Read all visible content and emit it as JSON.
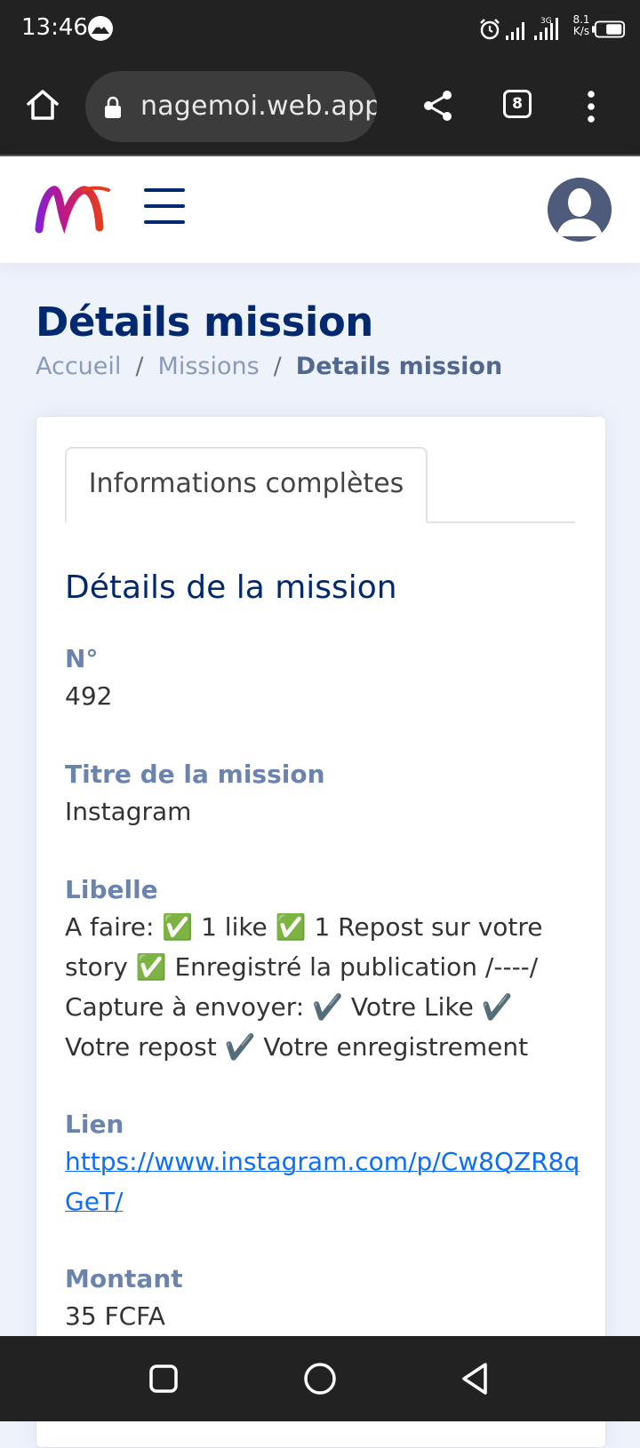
{
  "status_bar": {
    "time": "13:46",
    "net_speed_value": "8.1",
    "net_speed_unit": "K/s",
    "icons": [
      "mountain-notif-icon",
      "alarm-icon",
      "signal-icon",
      "signal-3g-icon",
      "battery-icon"
    ]
  },
  "browser": {
    "url": "nagemoi.web.app",
    "tab_count": "8",
    "icons": [
      "home-icon",
      "lock-icon",
      "share-icon",
      "tabs-icon",
      "more-vert-icon"
    ]
  },
  "header": {
    "logo": "M-logo",
    "menu_icon": "hamburger-icon",
    "avatar": "user-avatar"
  },
  "page": {
    "title": "Détails mission",
    "breadcrumb": [
      {
        "label": "Accueil"
      },
      {
        "label": "Missions"
      },
      {
        "label": "Details mission"
      }
    ],
    "breadcrumb_separator": "/"
  },
  "card": {
    "tab_label": "Informations complètes",
    "section_title": "Détails de la mission",
    "fields": [
      {
        "label": "N°",
        "value": "492"
      },
      {
        "label": "Titre de la mission",
        "value": "Instagram"
      },
      {
        "label": "Libelle",
        "value": "A faire: ✅ 1 like ✅ 1 Repost sur votre story ✅ Enregistré la publication /----/ Capture à envoyer: ✔️ Votre Like ✔️ Votre repost ✔️ Votre enregistrement"
      },
      {
        "label": "Lien",
        "value": "https://www.instagram.com/p/Cw8QZR8qGeT/"
      },
      {
        "label": "Montant",
        "value": "35 FCFA"
      }
    ]
  },
  "nav_bar": {
    "icons": [
      "recents-square-icon",
      "home-circle-icon",
      "back-triangle-icon"
    ]
  },
  "colors": {
    "primary": "#012970",
    "label": "#6b84ad",
    "link": "#0d6efd",
    "page_bg": "#eef2fb",
    "system_bar": "#222222"
  }
}
